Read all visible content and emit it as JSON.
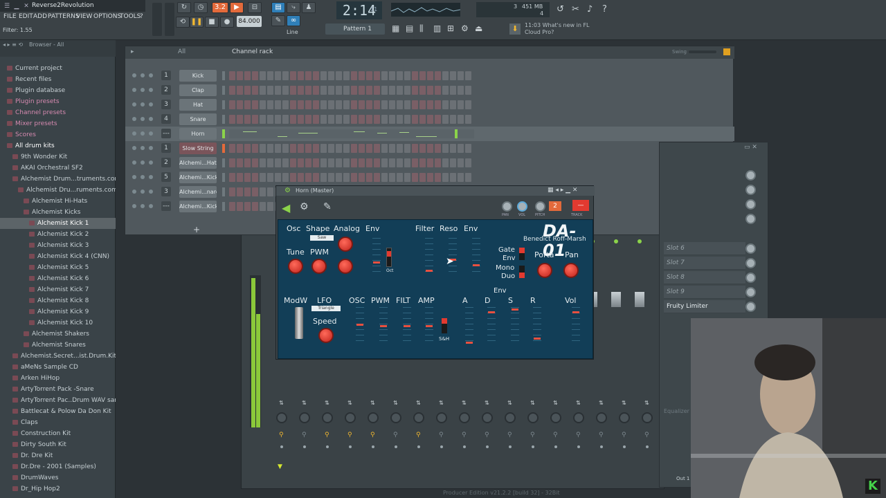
{
  "app": {
    "title": "Reverse2Revolution",
    "hint": "Filter: 1.55"
  },
  "menu": [
    "FILE",
    "EDIT",
    "ADD",
    "PATTERNS",
    "VIEW",
    "OPTIONS",
    "TOOLS",
    "?"
  ],
  "transport": {
    "badge": "3.2",
    "tempo": "84.000",
    "time": "2:14",
    "time_sub": "11",
    "pattern": "Pattern 1",
    "line": "Line",
    "news_time": "11:03",
    "news_text": "What's new in FL Cloud Pro?",
    "mem": "451 MB",
    "cpu_val": "3",
    "cpu_sub": "4"
  },
  "browser": {
    "header": "Browser - All",
    "items": [
      {
        "label": "Current project",
        "color": "#c7d0d4"
      },
      {
        "label": "Recent files",
        "color": "#c7d0d4"
      },
      {
        "label": "Plugin database",
        "color": "#c7d0d4"
      },
      {
        "label": "Plugin presets",
        "color": "#d68ab0"
      },
      {
        "label": "Channel presets",
        "color": "#d68ab0"
      },
      {
        "label": "Mixer presets",
        "color": "#d68ab0"
      },
      {
        "label": "Scores",
        "color": "#d68ab0"
      },
      {
        "label": "All drum kits",
        "color": "#ffffff"
      },
      {
        "label": "9th Wonder Kit",
        "color": "#c7d0d4"
      },
      {
        "label": "AKAI Orchestral SF2",
        "color": "#c7d0d4"
      },
      {
        "label": "Alchemist Drum...truments.com)",
        "color": "#c7d0d4"
      },
      {
        "label": "Alchemist Dru...ruments.com)",
        "color": "#c7d0d4"
      },
      {
        "label": "Alchemist Hi-Hats",
        "color": "#c7d0d4"
      },
      {
        "label": "Alchemist Kicks",
        "color": "#c7d0d4"
      },
      {
        "label": "Alchemist Kick 1",
        "color": "#ffffff"
      },
      {
        "label": "Alchemist Kick 2",
        "color": "#c7d0d4"
      },
      {
        "label": "Alchemist Kick 3",
        "color": "#c7d0d4"
      },
      {
        "label": "Alchemist Kick 4 (CNN)",
        "color": "#c7d0d4"
      },
      {
        "label": "Alchemist Kick 5",
        "color": "#c7d0d4"
      },
      {
        "label": "Alchemist Kick 6",
        "color": "#c7d0d4"
      },
      {
        "label": "Alchemist Kick 7",
        "color": "#c7d0d4"
      },
      {
        "label": "Alchemist Kick 8",
        "color": "#c7d0d4"
      },
      {
        "label": "Alchemist Kick 9",
        "color": "#c7d0d4"
      },
      {
        "label": "Alchemist Kick 10",
        "color": "#c7d0d4"
      },
      {
        "label": "Alchemist Shakers",
        "color": "#c7d0d4"
      },
      {
        "label": "Alchemist Snares",
        "color": "#c7d0d4"
      },
      {
        "label": "Alchemist.Secret...ist.Drum.Kit).WAV",
        "color": "#c7d0d4"
      },
      {
        "label": "aMeNs Sample CD",
        "color": "#c7d0d4"
      },
      {
        "label": "Arken HiHop",
        "color": "#c7d0d4"
      },
      {
        "label": "ArtyTorrent Pack -Snare",
        "color": "#c7d0d4"
      },
      {
        "label": "ArtyTorrent Pac..Drum WAV samples",
        "color": "#c7d0d4"
      },
      {
        "label": "Battlecat & Polow Da Don Kit",
        "color": "#c7d0d4"
      },
      {
        "label": "Claps",
        "color": "#c7d0d4"
      },
      {
        "label": "Construction Kit",
        "color": "#c7d0d4"
      },
      {
        "label": "Dirty South Kit",
        "color": "#c7d0d4"
      },
      {
        "label": "Dr. Dre Kit",
        "color": "#c7d0d4"
      },
      {
        "label": "Dr.Dre - 2001 (Samples)",
        "color": "#c7d0d4"
      },
      {
        "label": "DrumWaves",
        "color": "#c7d0d4"
      },
      {
        "label": "Dr_Hip Hop2",
        "color": "#c7d0d4"
      }
    ]
  },
  "rack": {
    "filter": "All",
    "title": "Channel rack",
    "swing": "Swing",
    "channels": [
      {
        "num": "1",
        "name": "Kick"
      },
      {
        "num": "2",
        "name": "Clap"
      },
      {
        "num": "3",
        "name": "Hat"
      },
      {
        "num": "4",
        "name": "Snare"
      },
      {
        "num": "---",
        "name": "Horn"
      },
      {
        "num": "1",
        "name": "Slow String"
      },
      {
        "num": "2",
        "name": "Alchemi...Hat 9"
      },
      {
        "num": "5",
        "name": "Alchemi...Kick 8"
      },
      {
        "num": "3",
        "name": "Alchemi...nare 6"
      },
      {
        "num": "---",
        "name": "Alchemi...Kick 1"
      }
    ],
    "add": "+"
  },
  "fx": {
    "slots": [
      "Slot 6",
      "Slot 7",
      "Slot 8",
      "Slot 9"
    ],
    "limiter": "Fruity Limiter",
    "equalizer": "Equalizer",
    "out": "Out 1"
  },
  "plugin": {
    "title": "Horn (Master)",
    "tabs": {
      "pan": "PAN",
      "vol": "VOL",
      "pitch": "PITCH",
      "range": "RANGE",
      "track": "TRACK",
      "track_num": "2"
    },
    "name": "DA-01",
    "author": "Benedict Roff-Marsh",
    "labels": {
      "osc": "Osc",
      "shape": "Shape",
      "analog": "Analog",
      "env1": "Env",
      "filter": "Filter",
      "reso": "Reso",
      "env2": "Env",
      "tune": "Tune",
      "pwm": "PWM",
      "gate": "Gate",
      "envg": "Env",
      "mono": "Mono",
      "duo": "Duo",
      "porta": "Porta",
      "pan": "Pan",
      "oct": "Oct",
      "saw": "Saw",
      "modw": "ModW",
      "lfo": "LFO",
      "triangle": "Triangle",
      "speed": "Speed",
      "osc2": "OSC",
      "pwm2": "PWM",
      "filt": "FILT",
      "amp": "AMP",
      "sh": "S&H",
      "env3": "Env",
      "a": "A",
      "d": "D",
      "s": "S",
      "r": "R",
      "vol": "Vol"
    }
  },
  "footer": "Producer Edition v21.2.2 [build 32] - 32Bit"
}
